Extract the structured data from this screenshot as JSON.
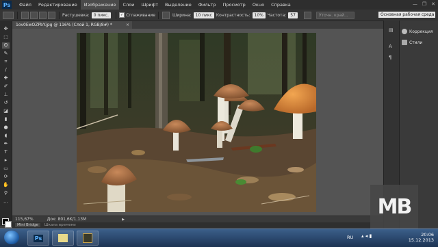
{
  "app": {
    "logo": "Ps"
  },
  "menu": {
    "items": [
      "Файл",
      "Редактирование",
      "Изображение",
      "Слои",
      "Шрифт",
      "Выделение",
      "Фильтр",
      "Просмотр",
      "Окно",
      "Справка"
    ],
    "active_index": 2
  },
  "window_controls": [
    "—",
    "❐",
    "✕"
  ],
  "options": {
    "feather_label": "Растушевка:",
    "feather_value": "0 пикс.",
    "antialias_label": "Сглаживание",
    "width_label": "Ширина:",
    "width_value": "10 пикс",
    "contrast_label": "Контрастность:",
    "contrast_value": "10%",
    "frequency_label": "Частота:",
    "frequency_value": "57",
    "refine_edge_label": "Уточн. край...",
    "workspace": "Основная рабочая среда"
  },
  "document": {
    "tab_title": "1ov0EwOZPbY.jpg @ 116% (Слой 1, RGB/8#) *",
    "close": "×"
  },
  "status": {
    "zoom": "115,67%",
    "doc_info": "Док: 801,6K/1,13M"
  },
  "bottom_tabs": [
    "Mini Bridge",
    "Шкала времени"
  ],
  "panels": {
    "items": [
      {
        "label": "Коррекция",
        "icon": "adjustments-icon"
      },
      {
        "label": "Стили",
        "icon": "styles-icon"
      }
    ]
  },
  "watermark": "MB",
  "taskbar": {
    "lang": "RU",
    "time": "20:06",
    "date": "15.12.2013"
  },
  "colors": {
    "accent": "#5fb3ff",
    "ps_logo_bg": "#0b2a4a",
    "mushroom_cap": "#d9883a"
  }
}
